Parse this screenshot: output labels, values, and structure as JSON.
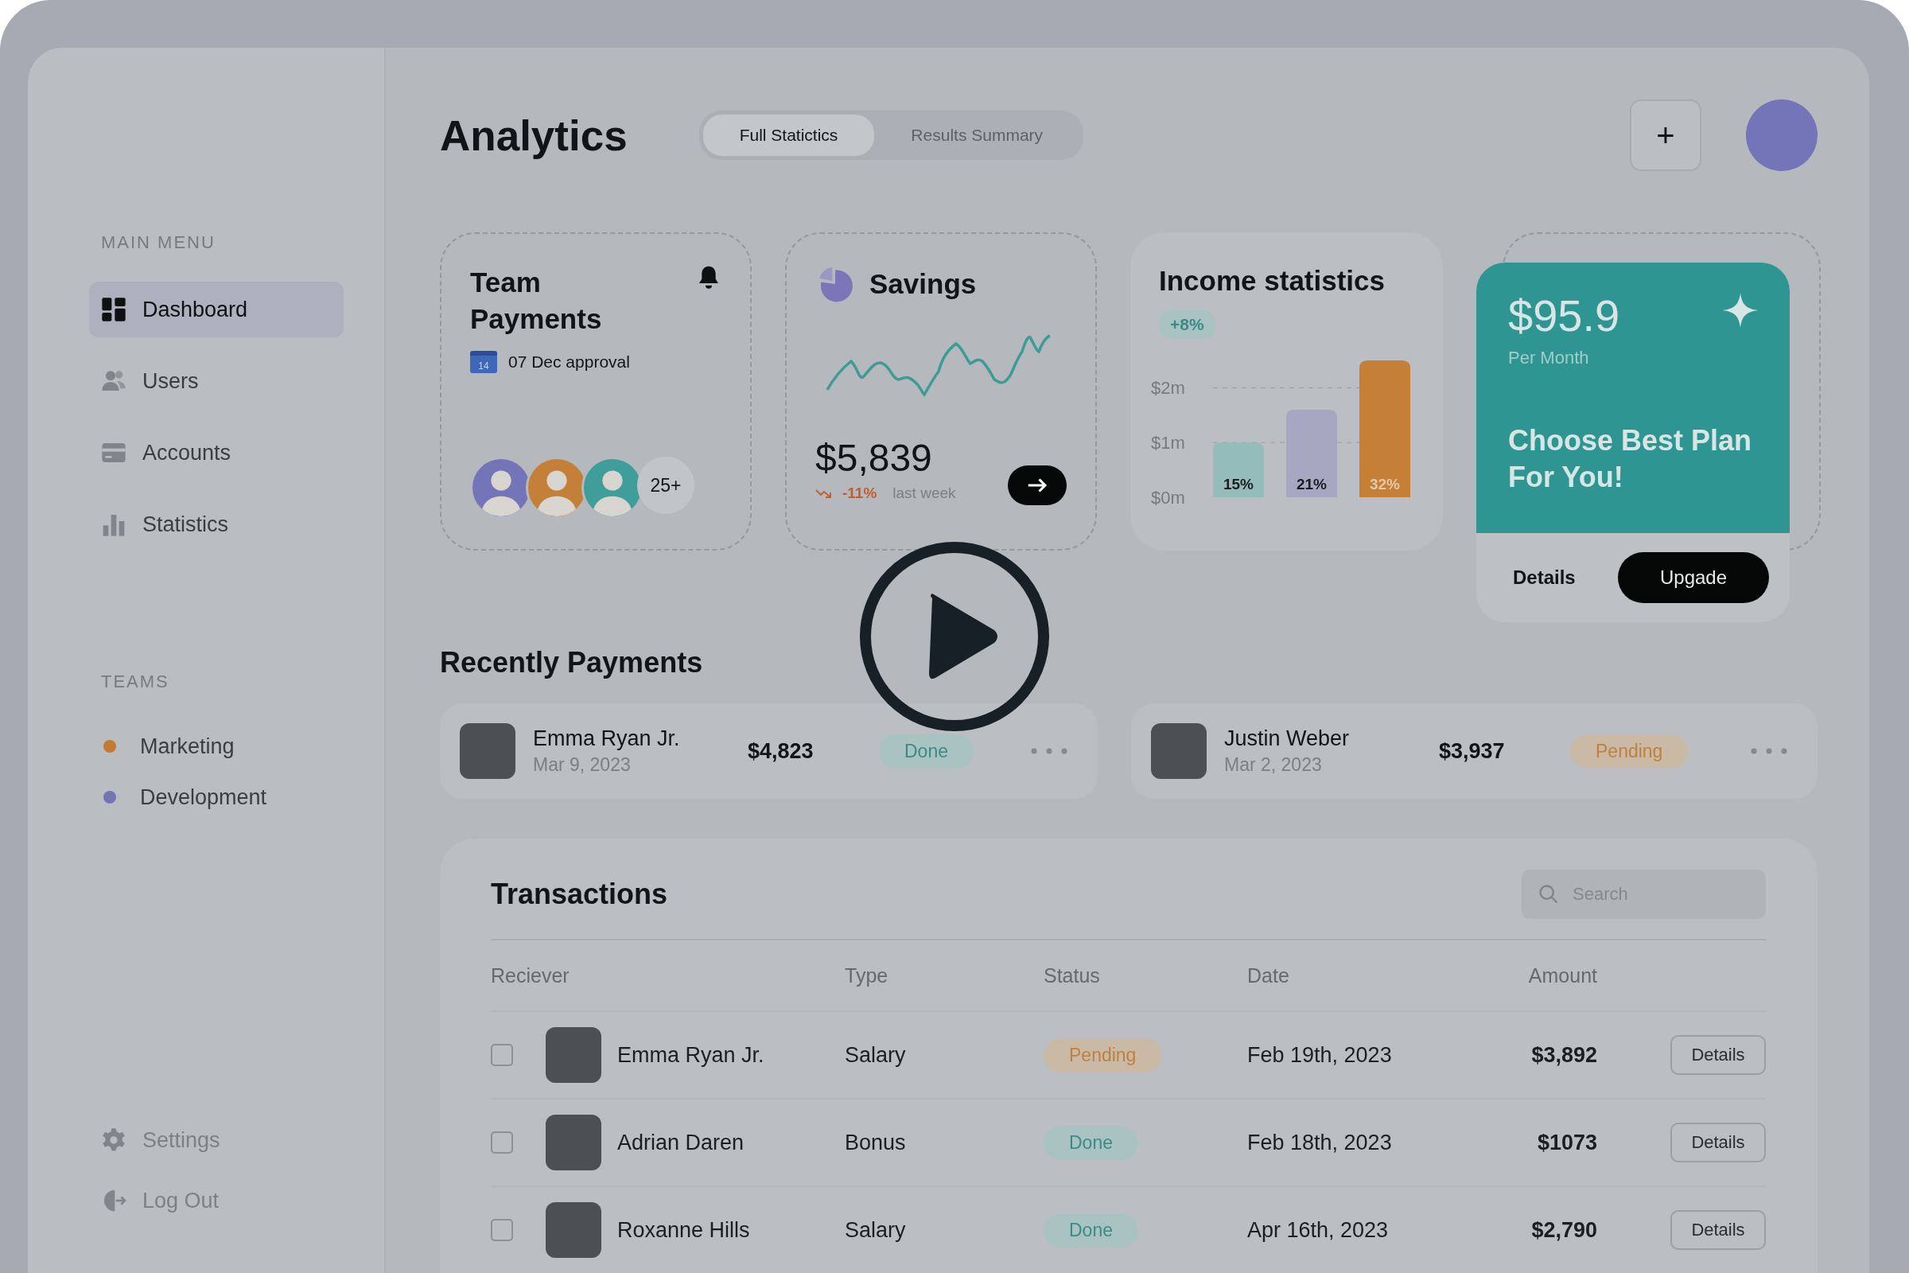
{
  "sidebar": {
    "main_menu_title": "MAIN MENU",
    "items": [
      {
        "label": "Dashboard",
        "kind": "grid",
        "selected": true
      },
      {
        "label": "Users",
        "kind": "users",
        "selected": false
      },
      {
        "label": "Accounts",
        "kind": "card",
        "selected": false
      },
      {
        "label": "Statistics",
        "kind": "bars",
        "selected": false
      }
    ],
    "teams_title": "TEAMS",
    "teams": [
      {
        "label": "Marketing",
        "color": "#c47a35"
      },
      {
        "label": "Development",
        "color": "#7474b4"
      }
    ],
    "footer_items": [
      {
        "label": "Settings",
        "kind": "gear"
      },
      {
        "label": "Log Out",
        "kind": "logout"
      }
    ]
  },
  "header": {
    "title": "Analytics",
    "tabs": [
      {
        "label": "Full Statictics",
        "selected": true
      },
      {
        "label": "Results Summary",
        "selected": false
      }
    ],
    "add_button": "+"
  },
  "team_payments": {
    "title": "Team Payments",
    "calendar_day": "14",
    "date": "07 Dec approval",
    "avatars": [
      {
        "color": "#7474b8"
      },
      {
        "color": "#c47f38"
      },
      {
        "color": "#3f9e9a"
      }
    ],
    "more_count": "25+"
  },
  "savings": {
    "title": "Savings",
    "amount": "$5,839",
    "change": "-11%",
    "period": "last week"
  },
  "income": {
    "title": "Income statistics",
    "badge": "+8%",
    "chart_data": {
      "type": "bar",
      "categories": [
        "15%",
        "21%",
        "32%"
      ],
      "values": [
        1.0,
        1.6,
        2.5
      ],
      "ylim": [
        0,
        2.5
      ],
      "yticks": [
        {
          "value": 0,
          "label": "$0m"
        },
        {
          "value": 1,
          "label": "$1m"
        },
        {
          "value": 2,
          "label": "$2m"
        }
      ]
    }
  },
  "plan": {
    "price": "$95.9",
    "period": "Per Month",
    "headline": "Choose Best Plan For You!",
    "buttons": [
      {
        "label": "Details",
        "kind": "plain"
      },
      {
        "label": "Upgade",
        "kind": "primary"
      }
    ]
  },
  "recent_payments": {
    "title": "Recently Payments",
    "items": [
      {
        "name": "Emma Ryan Jr.",
        "date": "Mar 9, 2023",
        "amount": "$4,823",
        "status": {
          "label": "Done",
          "kind": "done"
        }
      },
      {
        "name": "Justin Weber",
        "date": "Mar 2, 2023",
        "amount": "$3,937",
        "status": {
          "label": "Pending",
          "kind": "pending"
        }
      }
    ]
  },
  "transactions": {
    "title": "Transactions",
    "search": {
      "placeholder": "Search"
    },
    "columns": [
      "Reciever",
      "Type",
      "Status",
      "Date",
      "Amount"
    ],
    "rows": [
      {
        "checked": false,
        "name": "Emma Ryan Jr.",
        "type": "Salary",
        "status": {
          "label": "Pending",
          "kind": "pending"
        },
        "date": "Feb 19th, 2023",
        "amount": "$3,892",
        "action": "Details"
      },
      {
        "checked": false,
        "name": "Adrian Daren",
        "type": "Bonus",
        "status": {
          "label": "Done",
          "kind": "done"
        },
        "date": "Feb 18th, 2023",
        "amount": "$1073",
        "action": "Details"
      },
      {
        "checked": false,
        "name": "Roxanne Hills",
        "type": "Salary",
        "status": {
          "label": "Done",
          "kind": "done"
        },
        "date": "Apr 16th, 2023",
        "amount": "$2,790",
        "action": "Details"
      }
    ]
  }
}
